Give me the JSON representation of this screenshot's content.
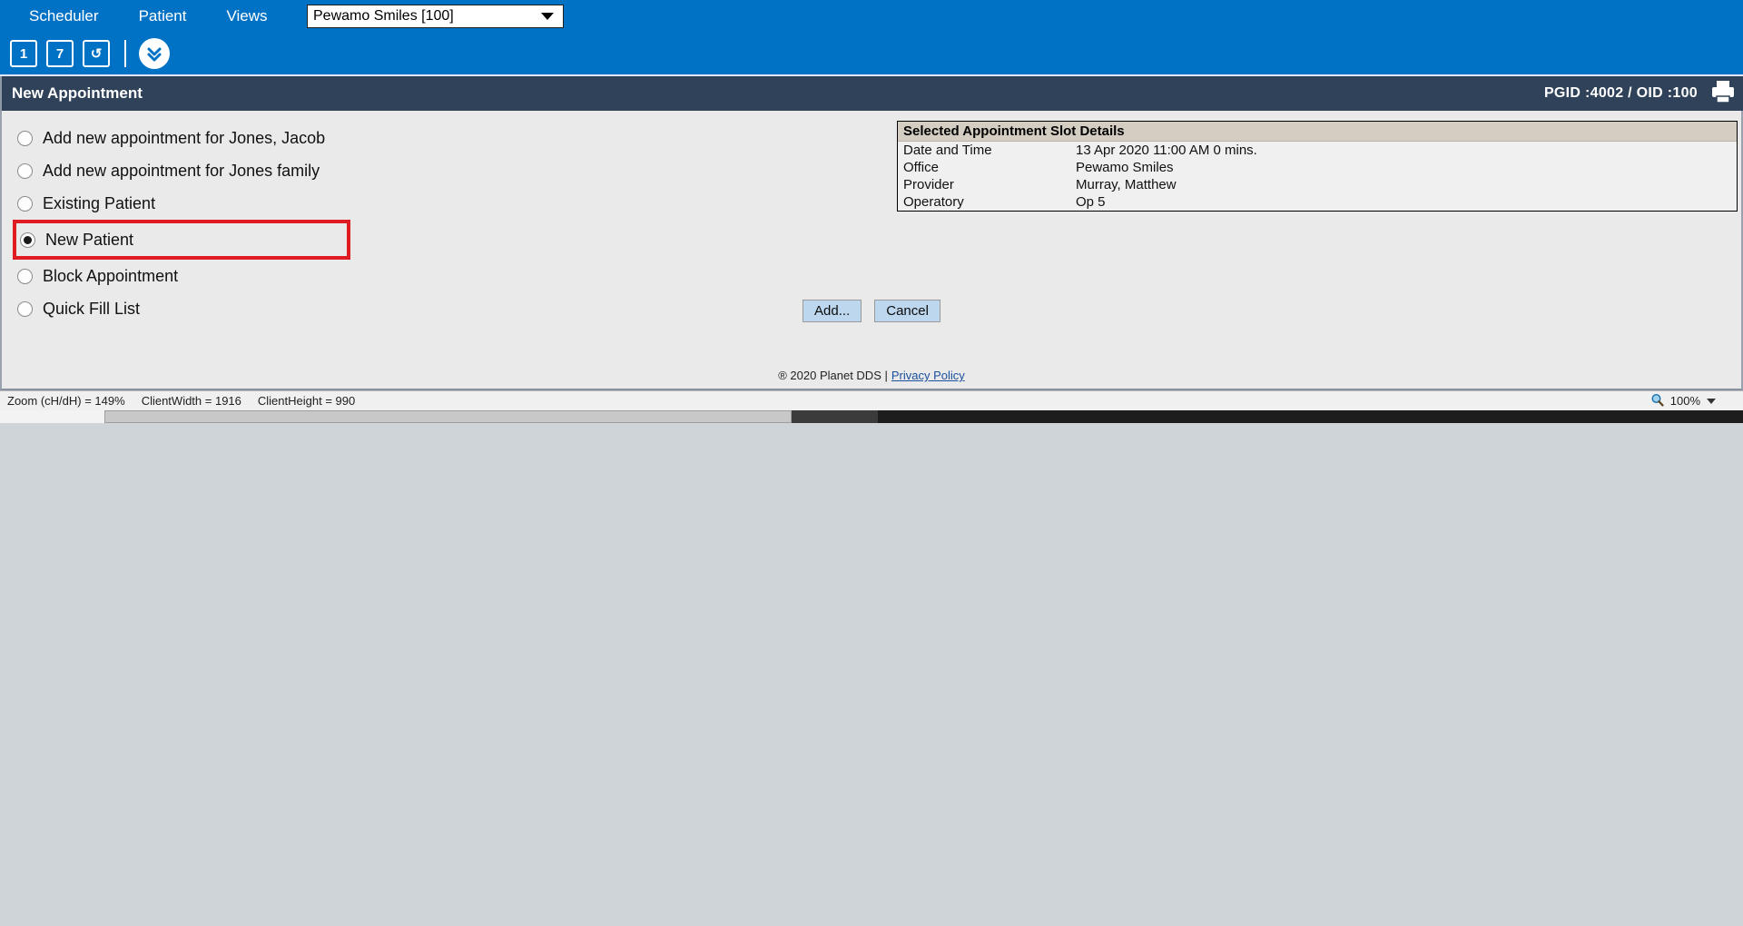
{
  "menubar": {
    "items": [
      {
        "label": "Scheduler"
      },
      {
        "label": "Patient"
      },
      {
        "label": "Views"
      }
    ],
    "office_select": {
      "value": "Pewamo Smiles [100]",
      "icon": "chevron-down-icon"
    }
  },
  "toolbar": {
    "buttons": [
      {
        "label": "1",
        "name": "day-view-button"
      },
      {
        "label": "7",
        "name": "week-view-button"
      },
      {
        "label": "↺",
        "name": "refresh-button"
      }
    ],
    "expand": {
      "icon": "double-chevron-down-icon"
    }
  },
  "header": {
    "title": "New Appointment",
    "pgid_oid": "PGID :4002  /  OID :100",
    "print_icon": "printer-icon"
  },
  "options": [
    {
      "label": "Add new appointment for Jones, Jacob",
      "checked": false,
      "highlighted": false
    },
    {
      "label": "Add new appointment for Jones family",
      "checked": false,
      "highlighted": false
    },
    {
      "label": "Existing Patient",
      "checked": false,
      "highlighted": false
    },
    {
      "label": "New Patient",
      "checked": true,
      "highlighted": true
    },
    {
      "label": "Block Appointment",
      "checked": false,
      "highlighted": false
    },
    {
      "label": "Quick Fill List",
      "checked": false,
      "highlighted": false
    }
  ],
  "slot_details": {
    "title": "Selected Appointment Slot Details",
    "rows": [
      {
        "key": "Date and Time",
        "value": "13 Apr 2020 11:00 AM 0 mins."
      },
      {
        "key": "Office",
        "value": "Pewamo Smiles"
      },
      {
        "key": "Provider",
        "value": "Murray, Matthew"
      },
      {
        "key": "Operatory",
        "value": "Op 5"
      }
    ]
  },
  "actions": {
    "add_label": "Add...",
    "cancel_label": "Cancel"
  },
  "footer": {
    "copyright": "® 2020 Planet DDS |",
    "privacy_label": "Privacy Policy"
  },
  "statusbar": {
    "zoom_info": "Zoom (cH/dH) = 149%",
    "client_width": "ClientWidth = 1916",
    "client_height": "ClientHeight = 990",
    "zoom_level": "100%",
    "zoom_icon": "magnifier-icon",
    "dropdown_icon": "chevron-down-icon"
  },
  "colors": {
    "menu_blue": "#0072c6",
    "header_navy": "#2f4259",
    "panel_gray": "#eaeaea",
    "highlight_red": "#e11b22",
    "button_blue": "#bdd7ee",
    "slot_title_tan": "#d4cec2"
  }
}
